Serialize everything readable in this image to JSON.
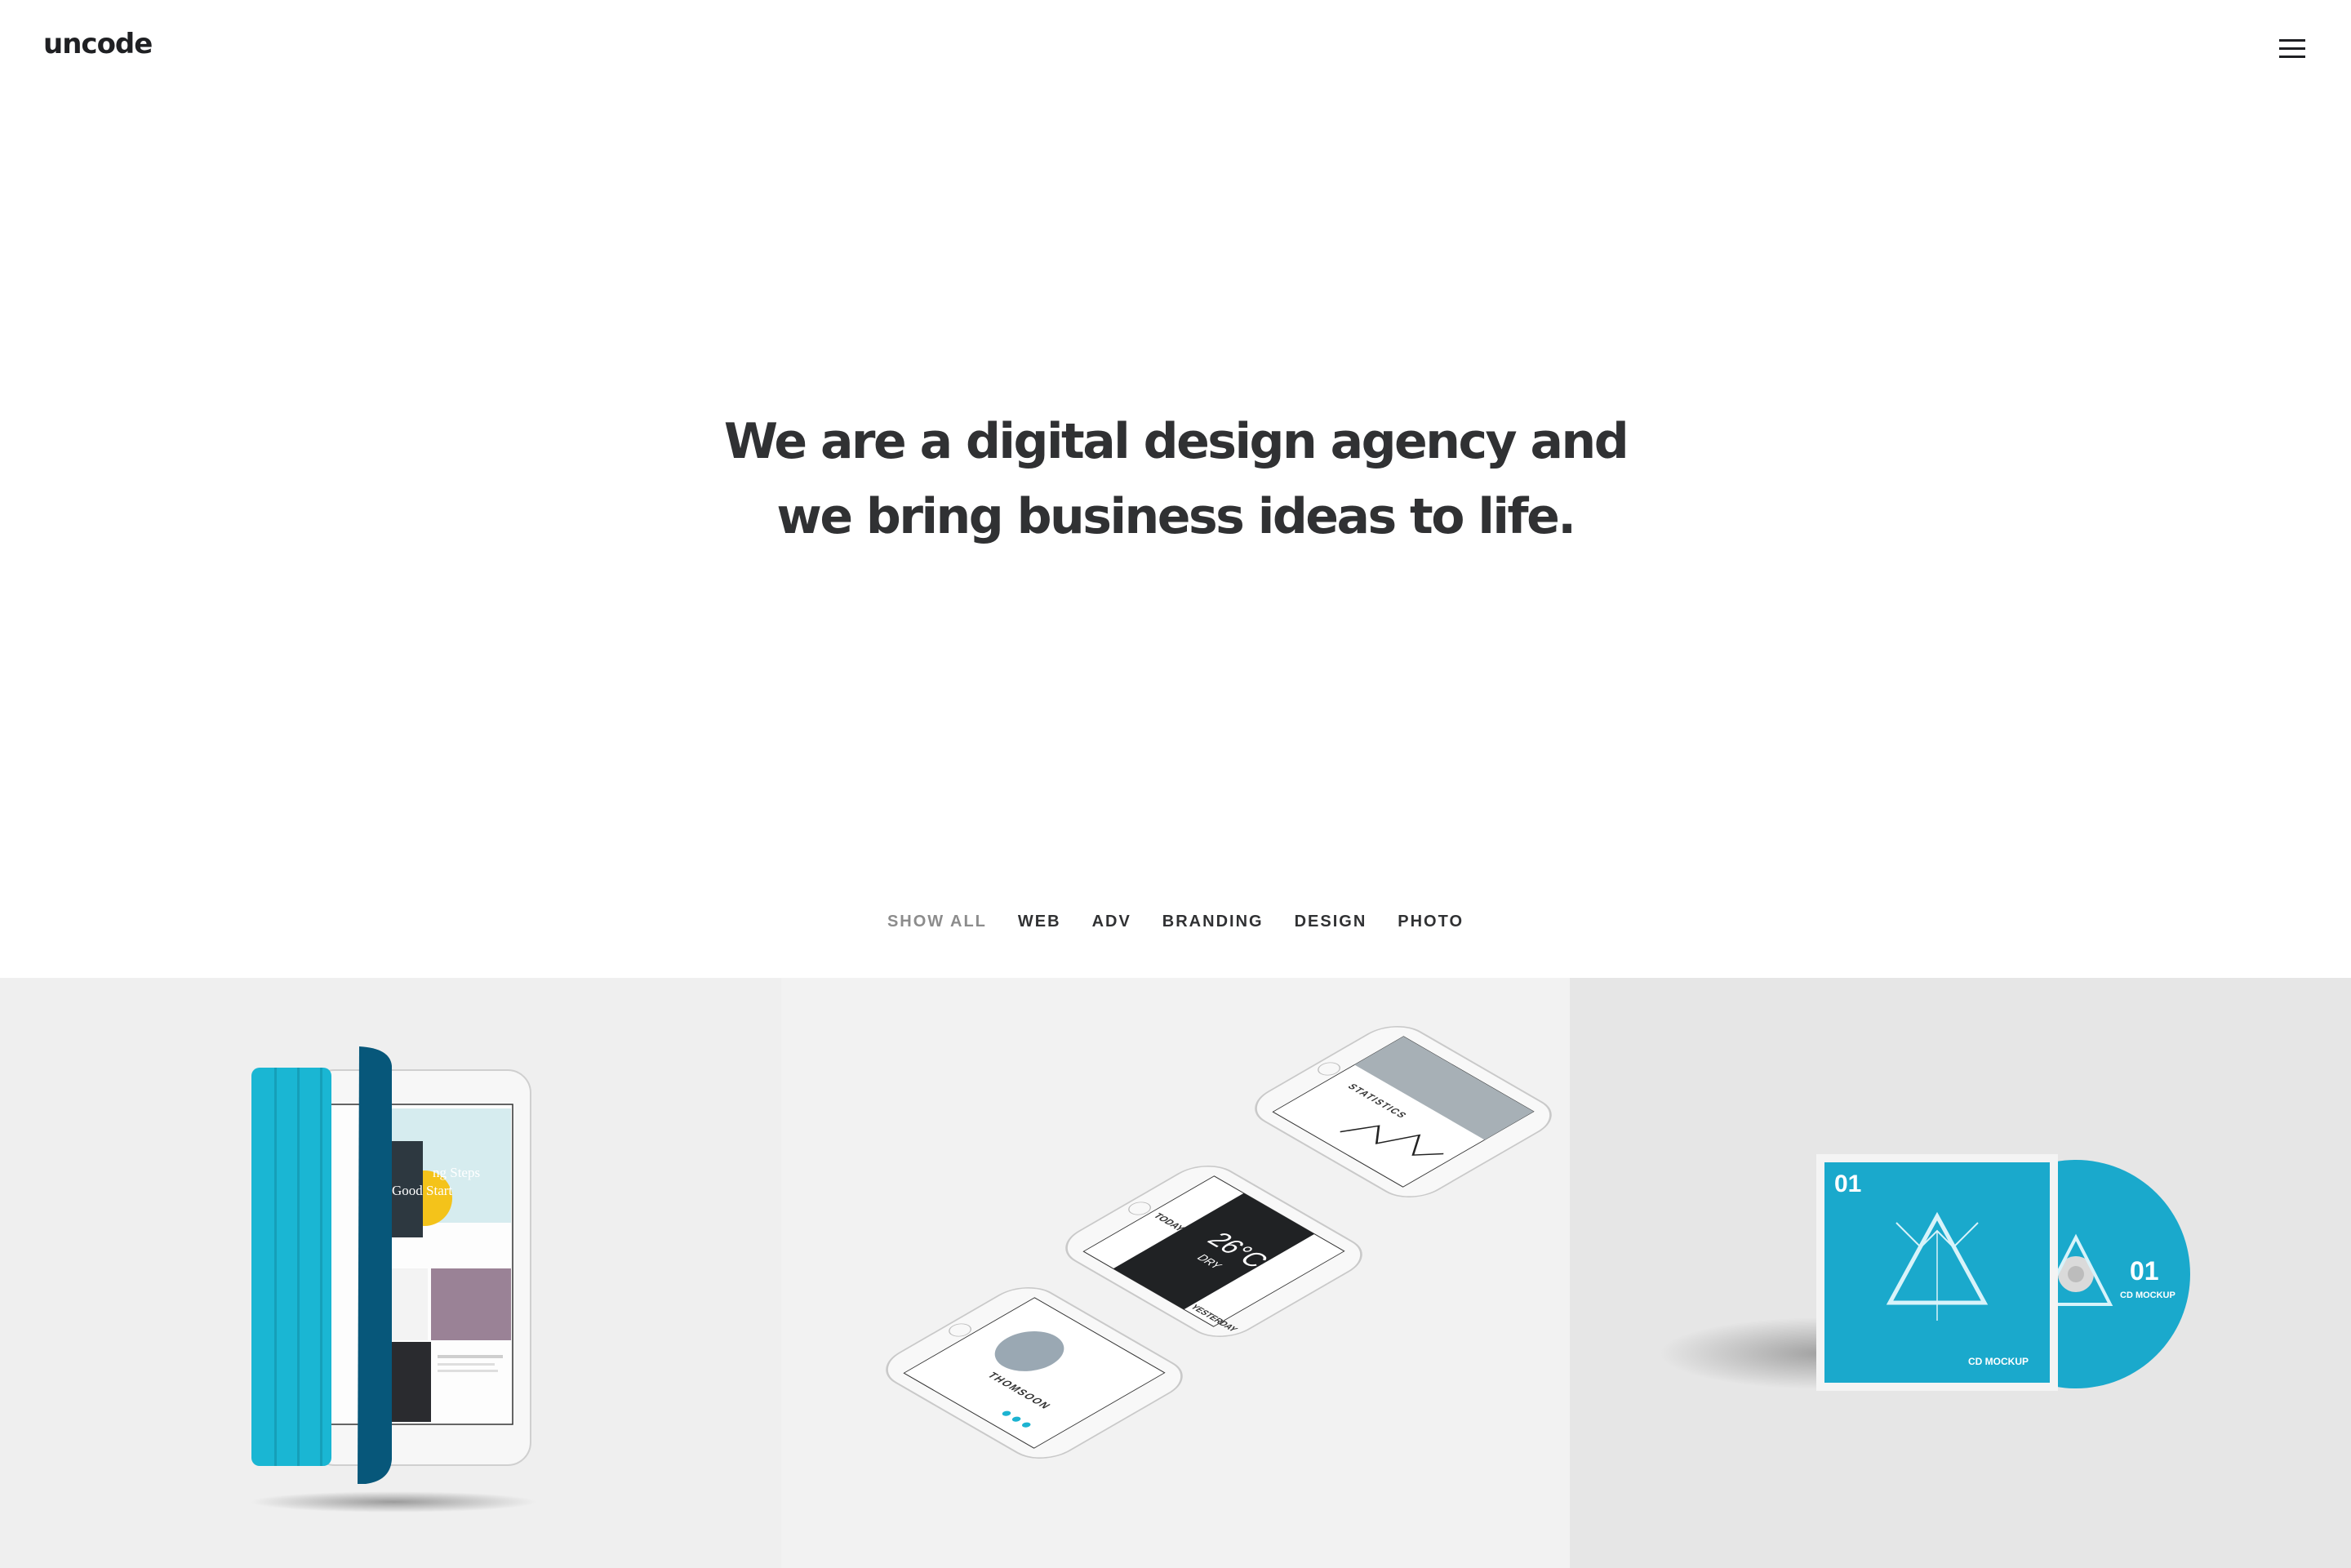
{
  "header": {
    "logo": "uncode",
    "menu_icon": "hamburger-menu-icon"
  },
  "hero": {
    "line1": "We are a digital design agency and",
    "line2": "we bring business ideas to life."
  },
  "filters": [
    {
      "label": "SHOW ALL",
      "active": true
    },
    {
      "label": "WEB",
      "active": false
    },
    {
      "label": "ADV",
      "active": false
    },
    {
      "label": "BRANDING",
      "active": false
    },
    {
      "label": "DESIGN",
      "active": false
    },
    {
      "label": "PHOTO",
      "active": false
    }
  ],
  "colors": {
    "text_dark": "#303133",
    "filter_active": "#8c8c8c",
    "accent_cyan": "#1cb3d1"
  },
  "portfolio": {
    "tile1": {
      "screen_lines": [
        "ng Steps",
        "Good Start"
      ]
    },
    "tile2": {
      "phone_stats": "STATISTICS",
      "phone_today": "TODAY",
      "temperature": "26°C",
      "condition": "DRY",
      "phone_yesterday": "YESTERDAY",
      "profile_name": "THOMSOON"
    },
    "tile3": {
      "case_number": "01",
      "disc_number": "01",
      "disc_label": "CD MOCKUP",
      "case_label": "CD MOCKUP"
    }
  }
}
